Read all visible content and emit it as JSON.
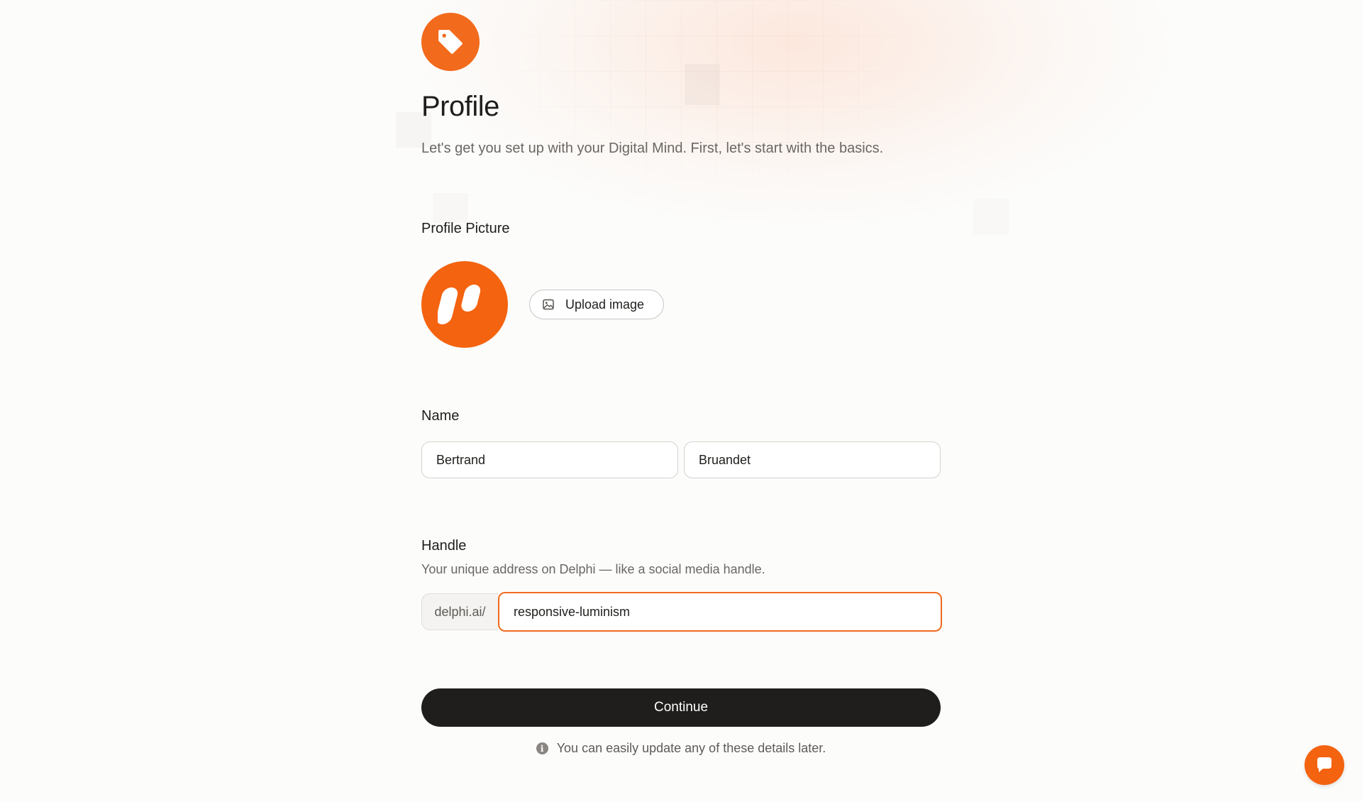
{
  "page": {
    "title": "Profile",
    "subtitle": "Let's get you set up with your Digital Mind. First, let's start with the basics."
  },
  "profile_picture": {
    "label": "Profile Picture",
    "upload_label": "Upload image"
  },
  "name": {
    "label": "Name",
    "first_name": "Bertrand",
    "last_name": "Bruandet"
  },
  "handle": {
    "label": "Handle",
    "hint": "Your unique address on Delphi — like a social media handle.",
    "prefix": "delphi.ai/",
    "value": "responsive-luminism"
  },
  "actions": {
    "continue_label": "Continue",
    "note": "You can easily update any of these details later."
  },
  "icons": {
    "header": "tag-icon",
    "avatar": "delphi-logo",
    "upload": "image-icon",
    "note": "info-icon",
    "chat": "chat-bubble-icon"
  },
  "colors": {
    "accent": "#f4630f",
    "primary_button": "#1f1e1c",
    "focus_border": "#f06a1f"
  }
}
